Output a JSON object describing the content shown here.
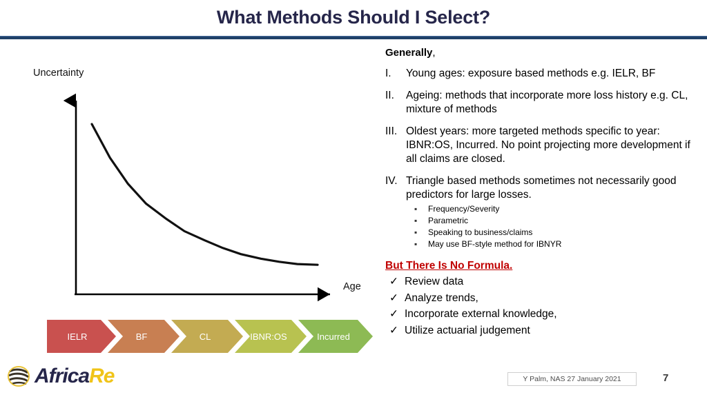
{
  "slide": {
    "title": "What Methods Should I Select?",
    "accent_navy": "#26264a",
    "rule_color": "#1f4068",
    "red_accent": "#c00000"
  },
  "chart_data": {
    "type": "line",
    "title": "",
    "xlabel": "Age",
    "ylabel": "Uncertainty",
    "grid": false,
    "legend": null,
    "axis_ticks": [],
    "description": "Decaying curve showing uncertainty falling as age increases",
    "x": [
      0,
      0.08,
      0.16,
      0.24,
      0.33,
      0.41,
      0.5,
      0.58,
      0.66,
      0.75,
      0.83,
      0.91,
      1.0
    ],
    "y": [
      1.0,
      0.78,
      0.61,
      0.48,
      0.38,
      0.3,
      0.24,
      0.19,
      0.15,
      0.12,
      0.1,
      0.085,
      0.08
    ],
    "xlim": [
      0,
      1
    ],
    "ylim": [
      0,
      1
    ]
  },
  "process": {
    "name": "method-progression",
    "steps": [
      {
        "label": "IELR",
        "color": "#c9514f"
      },
      {
        "label": "BF",
        "color": "#c87f52"
      },
      {
        "label": "CL",
        "color": "#c3ab52"
      },
      {
        "label": "IBNR:OS",
        "color": "#b8c250"
      },
      {
        "label": "Incurred",
        "color": "#8dba54"
      }
    ]
  },
  "content": {
    "generally_label": "Generally",
    "generally_comma": ",",
    "points": [
      {
        "marker": "I.",
        "text": "Young ages: exposure based methods e.g. IELR, BF"
      },
      {
        "marker": "II.",
        "text": "Ageing: methods that incorporate more loss history e.g. CL, mixture of methods"
      },
      {
        "marker": "III.",
        "text": "Oldest years: more targeted methods specific to year: IBNR:OS, Incurred. No point projecting more development if all claims are closed."
      },
      {
        "marker": "IV.",
        "text": "Triangle based methods sometimes not necessarily good predictors for large losses.",
        "subpoints": [
          "Frequency/Severity",
          "Parametric",
          "Speaking to business/claims",
          "May use BF-style method for IBNYR"
        ]
      }
    ],
    "conclusion_heading": "But There Is No Formula.",
    "conclusion_items": [
      "Review data",
      "Analyze trends,",
      "Incorporate external knowledge,",
      "Utilize actuarial judgement"
    ],
    "bullet_glyph": "▪",
    "check_glyph": "✓"
  },
  "footer": {
    "logo_africa": "Africa",
    "logo_re": "Re",
    "badge_text": "Y Palm, NAS 27 January 2021",
    "page_number": "7"
  }
}
